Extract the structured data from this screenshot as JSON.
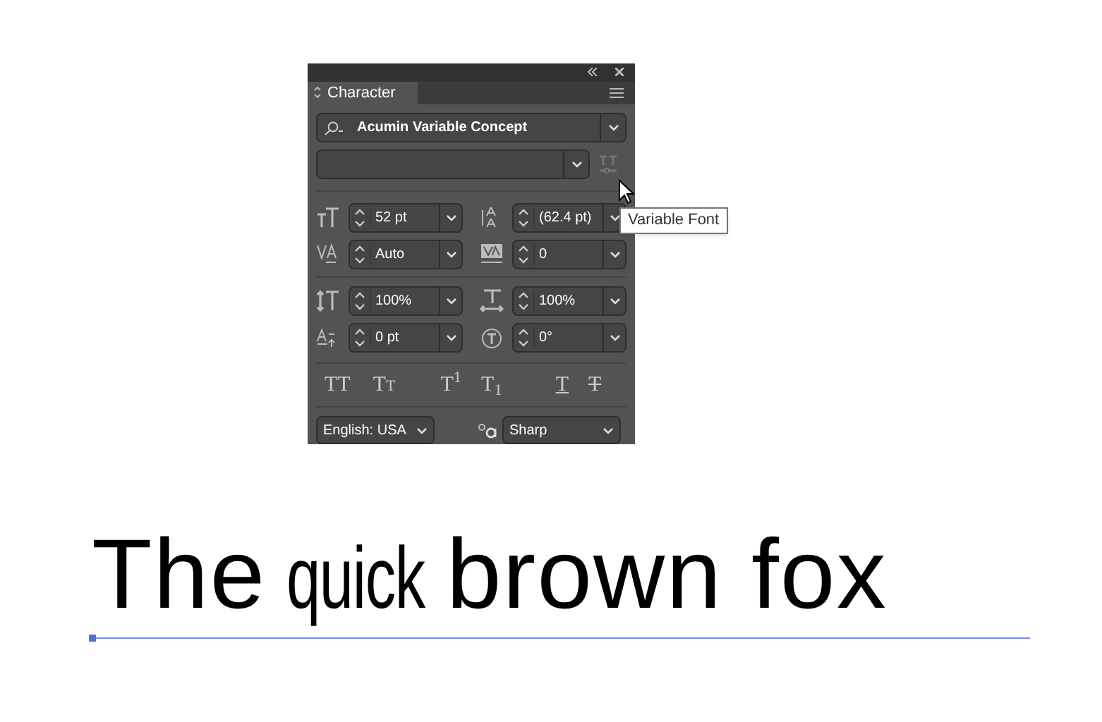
{
  "panel": {
    "tab": "Character",
    "font_family": "Acumin Variable Concept",
    "metrics": [
      {
        "kind": "size",
        "value": "52 pt"
      },
      {
        "kind": "leading",
        "value": "(62.4 pt)"
      },
      {
        "kind": "kerning",
        "value": "Auto"
      },
      {
        "kind": "tracking",
        "value": "0"
      },
      {
        "kind": "vscale",
        "value": "100%"
      },
      {
        "kind": "hscale",
        "value": "100%"
      },
      {
        "kind": "baseline",
        "value": "0 pt"
      },
      {
        "kind": "rotation",
        "value": "0°"
      }
    ],
    "style_buttons": [
      {
        "kind": "plain",
        "label": "TT"
      },
      {
        "kind": "smallcaps",
        "label": "Tt"
      },
      {
        "kind": "plain",
        "label": "T$^{1}$"
      },
      {
        "kind": "plain",
        "label": "T$_{1}$"
      },
      {
        "kind": "underline",
        "label": "T"
      },
      {
        "kind": "strike",
        "label": "T"
      }
    ],
    "language": "English: USA",
    "antialias": "Sharp"
  },
  "tooltip": "Variable Font",
  "sample_text": [
    {
      "kind": "normal",
      "text": "The"
    },
    {
      "kind": "condensed",
      "text": "quick"
    },
    {
      "kind": "wide",
      "text": "brown fox"
    }
  ]
}
